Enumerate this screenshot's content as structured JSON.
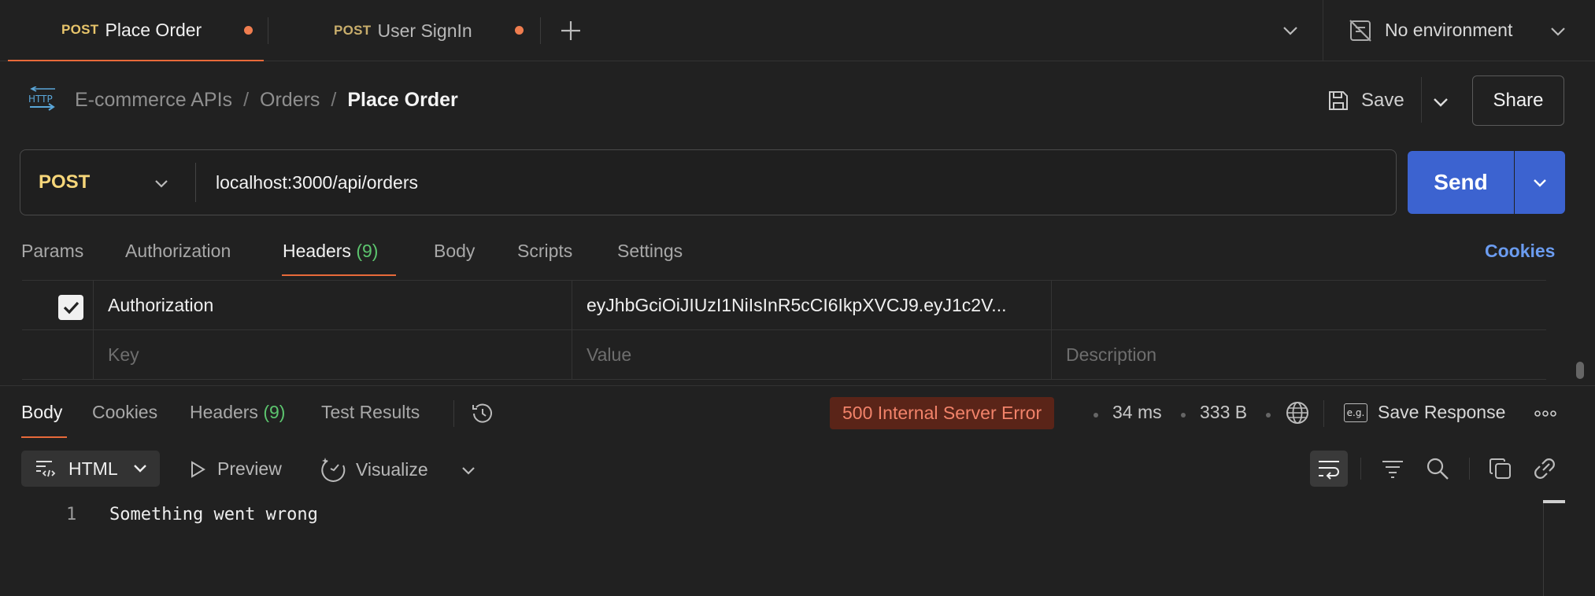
{
  "tabs": [
    {
      "method": "POST",
      "title": "Place Order",
      "active": true,
      "unsaved": true
    },
    {
      "method": "POST",
      "title": "User SignIn",
      "active": false,
      "unsaved": true
    }
  ],
  "environment": {
    "label": "No environment"
  },
  "breadcrumb": {
    "icon_text": "HTTP",
    "collection": "E-commerce APIs",
    "folder": "Orders",
    "separator": "/",
    "current": "Place Order"
  },
  "actions": {
    "save_label": "Save",
    "share_label": "Share"
  },
  "request": {
    "method": "POST",
    "url": "localhost:3000/api/orders",
    "send_label": "Send"
  },
  "request_tabs": {
    "params": "Params",
    "authorization": "Authorization",
    "headers": "Headers",
    "headers_count": "(9)",
    "body": "Body",
    "scripts": "Scripts",
    "settings": "Settings",
    "cookies_link": "Cookies"
  },
  "headers_table": {
    "rows": [
      {
        "checked": true,
        "key": "Authorization",
        "value": "eyJhbGciOiJIUzI1NiIsInR5cCI6IkpXVCJ9.eyJ1c2V...",
        "description": ""
      }
    ],
    "placeholder": {
      "key": "Key",
      "value": "Value",
      "description": "Description"
    }
  },
  "response_tabs": {
    "body": "Body",
    "cookies": "Cookies",
    "headers": "Headers",
    "headers_count": "(9)",
    "test_results": "Test Results"
  },
  "response_meta": {
    "status": "500 Internal Server Error",
    "time": "34 ms",
    "size": "333 B",
    "save_response_label": "Save Response",
    "eg_icon_text": "e.g."
  },
  "body_toolbar": {
    "format": "HTML",
    "preview": "Preview",
    "visualize": "Visualize"
  },
  "response_body": {
    "lines": [
      {
        "number": "1",
        "text": "Something went wrong"
      }
    ]
  },
  "colors": {
    "accent_orange": "#e86a3a",
    "method_post": "#f6d67a",
    "send_blue": "#3c63d0",
    "cookies_link": "#6b9cf0",
    "count_green": "#5cc46e",
    "error_bg": "#5a2418",
    "error_text": "#f2836a"
  }
}
